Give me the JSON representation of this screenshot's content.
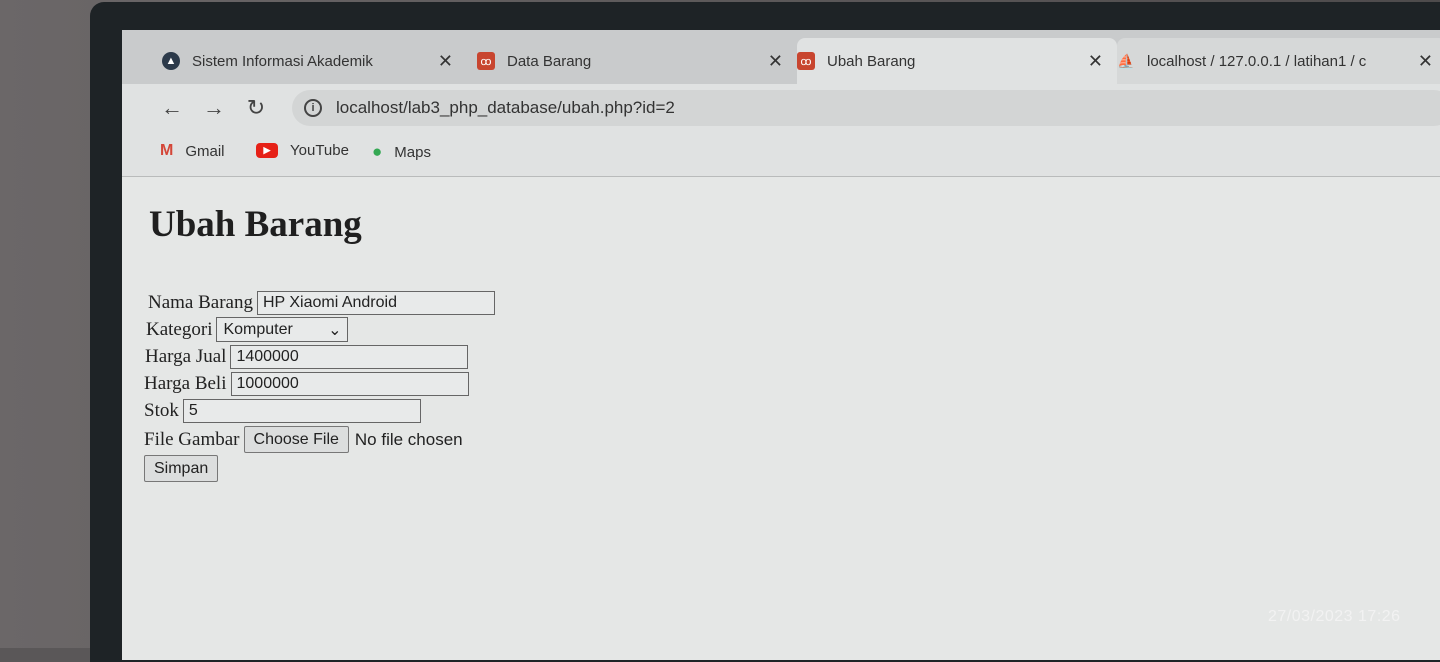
{
  "tabs": [
    {
      "title": "Sistem Informasi Akademik",
      "icon": "university-icon"
    },
    {
      "title": "Data Barang",
      "icon": "xampp-icon"
    },
    {
      "title": "Ubah Barang",
      "icon": "xampp-icon"
    },
    {
      "title": "localhost / 127.0.0.1 / latihan1 / c",
      "icon": "phpmyadmin-icon"
    }
  ],
  "close_glyph": "✕",
  "toolbar": {
    "url": "localhost/lab3_php_database/ubah.php?id=2"
  },
  "bookmarks": [
    {
      "label": "Gmail",
      "icon": "gmail-icon"
    },
    {
      "label": "YouTube",
      "icon": "youtube-icon"
    },
    {
      "label": "Maps",
      "icon": "maps-icon"
    }
  ],
  "page": {
    "heading": "Ubah Barang",
    "fields": {
      "nama_label": "Nama Barang",
      "nama_value": "HP Xiaomi Android",
      "kategori_label": "Kategori",
      "kategori_value": "Komputer",
      "harga_jual_label": "Harga Jual",
      "harga_jual_value": "1400000",
      "harga_beli_label": "Harga Beli",
      "harga_beli_value": "1000000",
      "stok_label": "Stok",
      "stok_value": "5",
      "gambar_label": "File Gambar",
      "choose_file": "Choose File",
      "no_file": "No file chosen"
    },
    "submit": "Simpan"
  },
  "photo_timestamp": "27/03/2023 17:26"
}
